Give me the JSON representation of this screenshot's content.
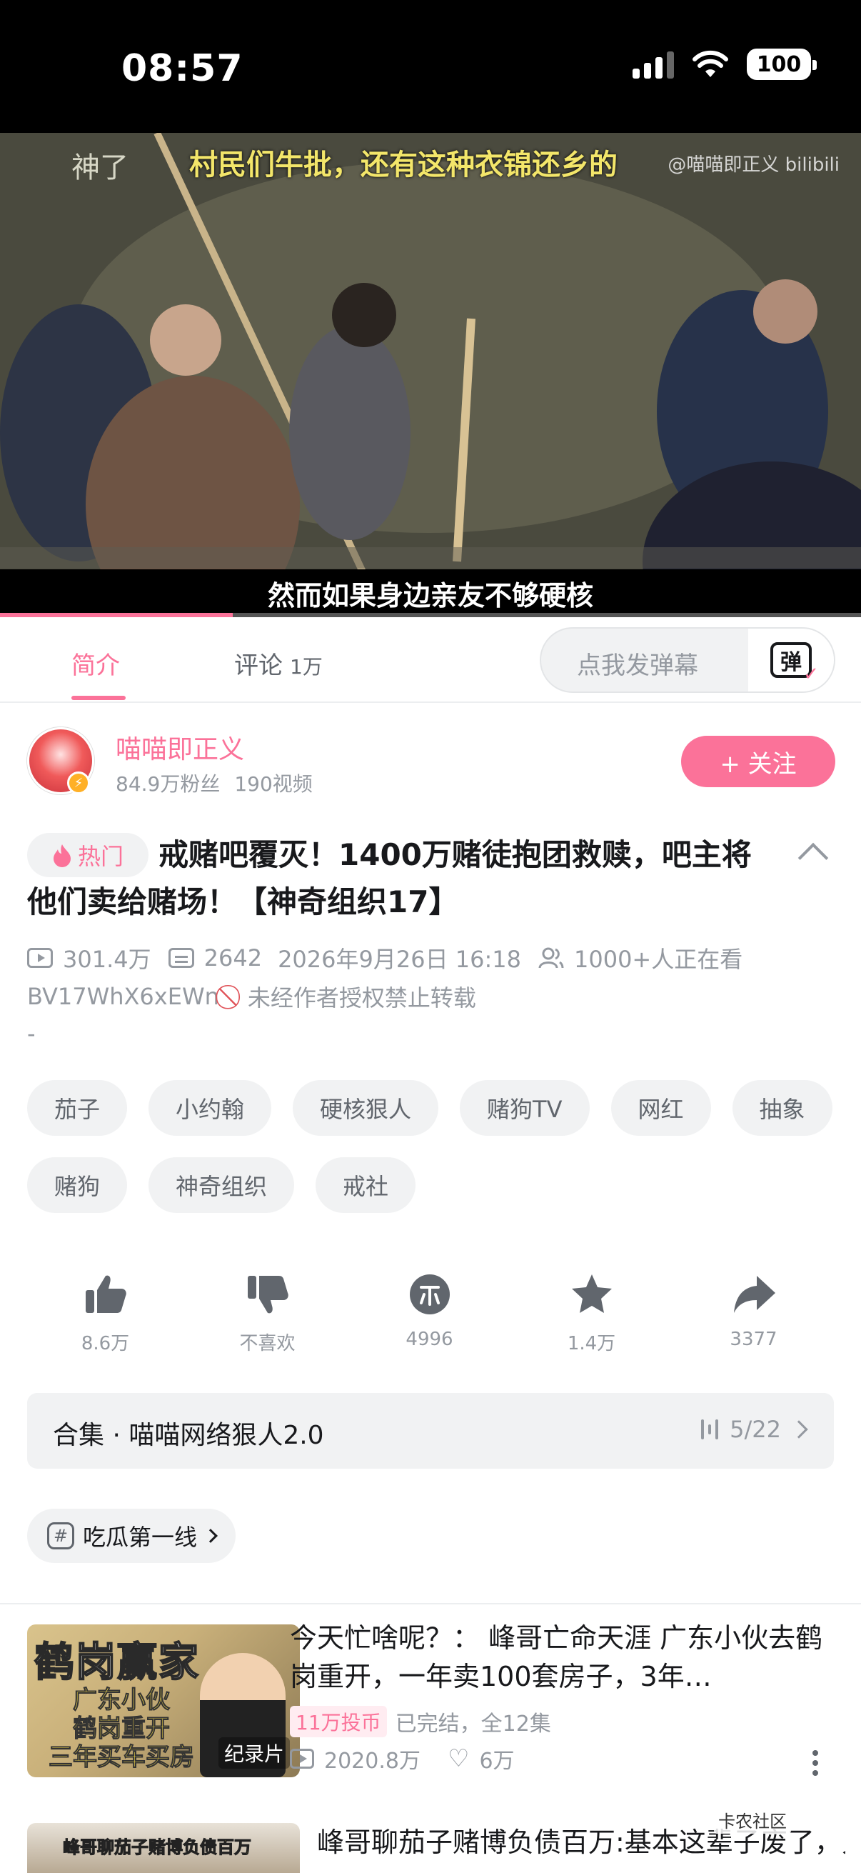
{
  "status_bar": {
    "time": "08:57",
    "battery": "100"
  },
  "video": {
    "top_left_text": "神了",
    "top_caption": "村民们牛批，还有这种衣锦还乡的",
    "watermark": "@喵喵即正义 bilibili",
    "subtitle": "然而如果身边亲友不够硬核",
    "progress": 0.27
  },
  "tabs": [
    {
      "label": "简介",
      "count": ""
    },
    {
      "label": "评论",
      "count": "1万"
    }
  ],
  "danmaku": {
    "placeholder": "点我发弹幕",
    "button": "弹"
  },
  "uploader": {
    "name": "喵喵即正义",
    "fans": "84.9万粉丝",
    "videos": "190视频",
    "follow_label": "+ 关注"
  },
  "video_info": {
    "hot_label": "热门",
    "title": "戒赌吧覆灭！1400万赌徒抱团救赎，吧主将他们卖给赌场！【神奇组织17】",
    "views": "301.4万",
    "danmaku_count": "2642",
    "date": "2026年9月26日 16:18",
    "watching": "1000+人正在看",
    "bvid": "BV17WhX6xEWn",
    "no_repost": "未经作者授权禁止转载",
    "description": "-"
  },
  "tags": [
    "茄子",
    "小约翰",
    "硬核狠人",
    "赌狗TV",
    "网红",
    "抽象",
    "赌狗",
    "神奇组织",
    "戒社"
  ],
  "actions": [
    {
      "icon": "thumbs-up-icon",
      "label": "8.6万"
    },
    {
      "icon": "thumbs-down-icon",
      "label": "不喜欢"
    },
    {
      "icon": "coin-icon",
      "label": "4996"
    },
    {
      "icon": "star-icon",
      "label": "1.4万"
    },
    {
      "icon": "share-icon",
      "label": "3377"
    }
  ],
  "collection": {
    "title": "合集 · 喵喵网络狠人2.0",
    "progress": "5/22"
  },
  "topic": {
    "label": "吃瓜第一线"
  },
  "recommendations": [
    {
      "thumb_title": "鹤岗赢家",
      "thumb_subtitle": "广东小伙\n鹤岗重开\n三年买车买房",
      "thumb_tag": "纪录片",
      "title": "今天忙啥呢？： 峰哥亡命天涯 广东小伙去鹤岗重开，一年卖100套房子，3年…",
      "coin_badge": "11万投币",
      "status": "已完结，全12集",
      "views": "2020.8万",
      "likes": "6万"
    },
    {
      "thumb_title": "峰哥聊茄子赌博负债百万",
      "title": "峰哥聊茄子赌博负债百万:基本这辈子废了，只要跟人接触有欲望，那想本或"
    }
  ],
  "community_watermark": "卡农社区"
}
